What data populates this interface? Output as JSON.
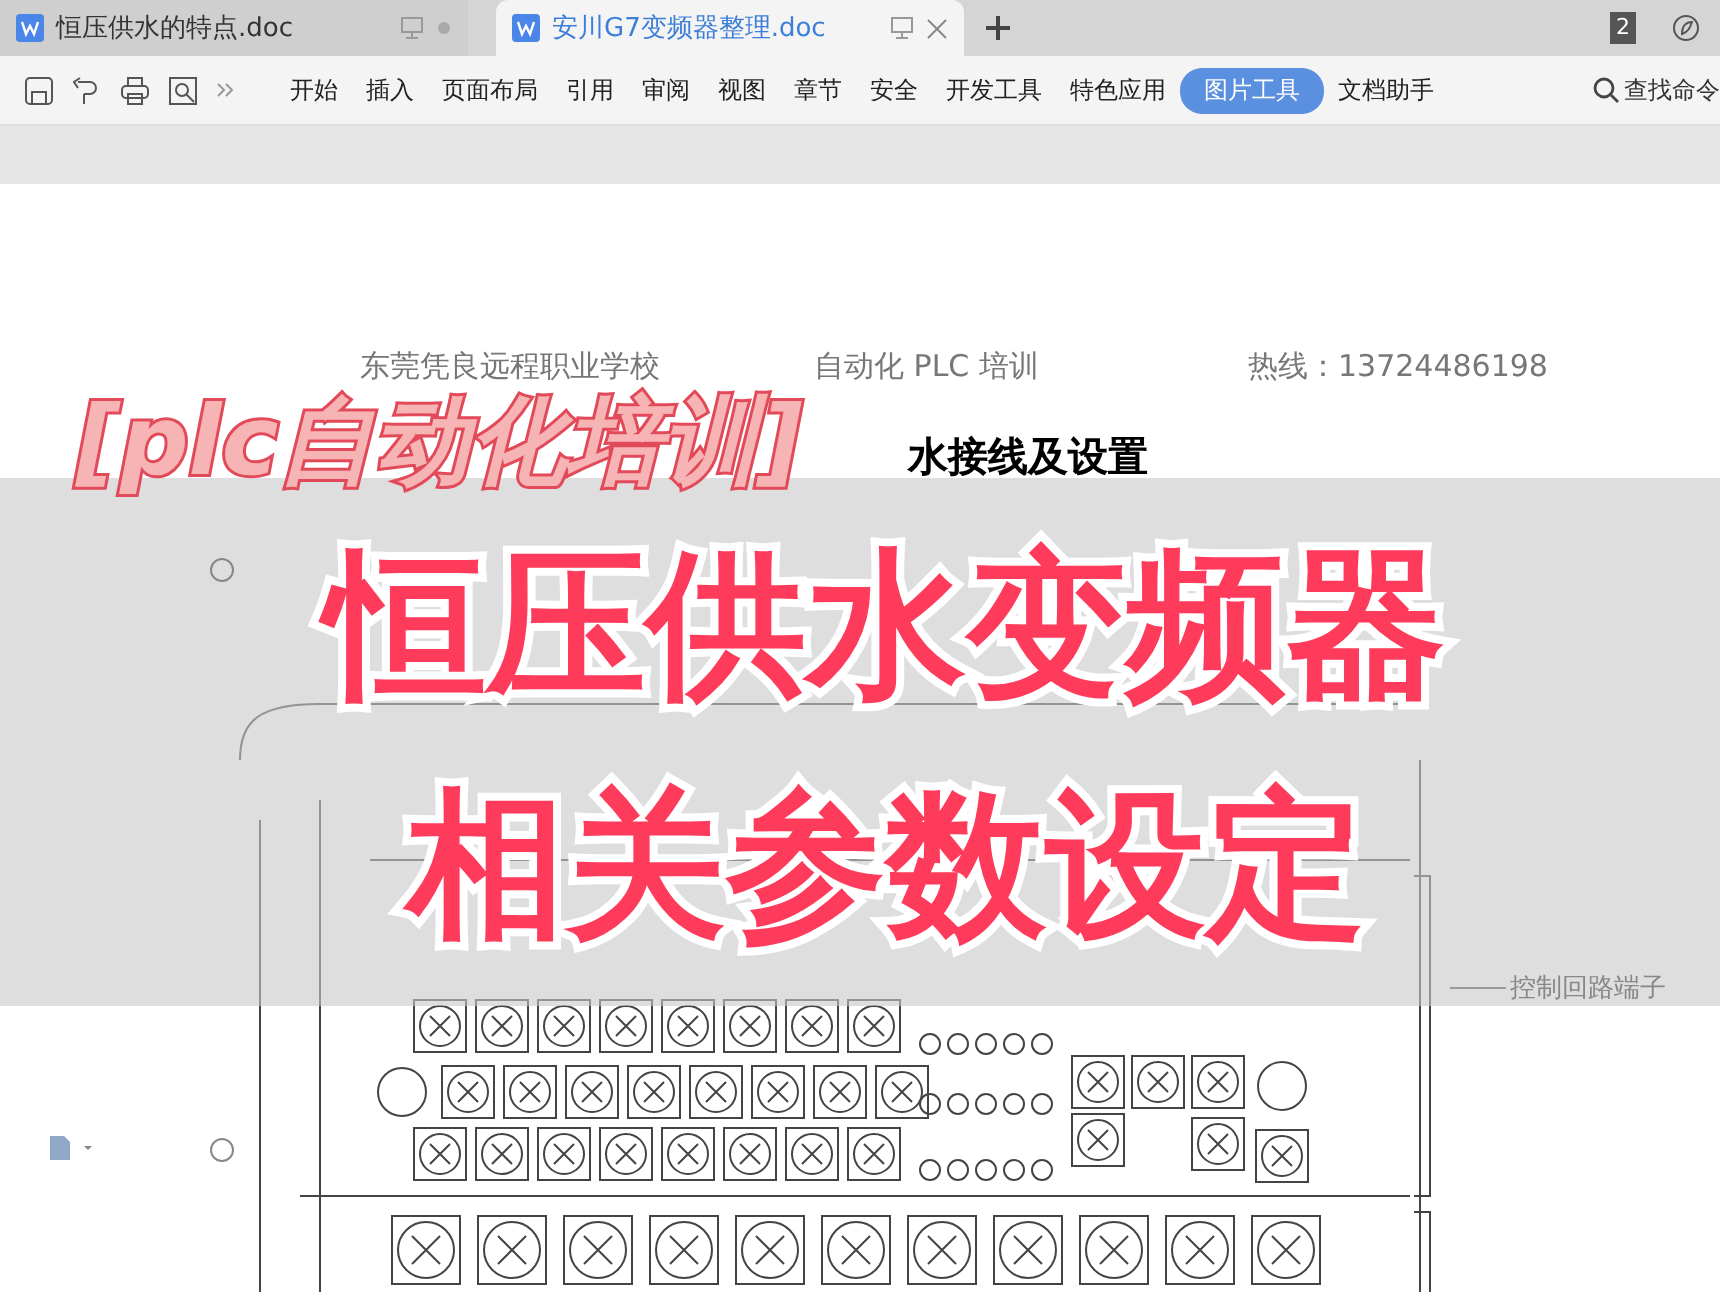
{
  "tabs": [
    {
      "label": "恒压供水的特点.doc",
      "selected": false
    },
    {
      "label": "安川G7变频器整理.doc",
      "selected": true
    }
  ],
  "tab_badge": "2",
  "menu": [
    {
      "label": "开始",
      "selected": false
    },
    {
      "label": "插入",
      "selected": false
    },
    {
      "label": "页面布局",
      "selected": false
    },
    {
      "label": "引用",
      "selected": false
    },
    {
      "label": "审阅",
      "selected": false
    },
    {
      "label": "视图",
      "selected": false
    },
    {
      "label": "章节",
      "selected": false
    },
    {
      "label": "安全",
      "selected": false
    },
    {
      "label": "开发工具",
      "selected": false
    },
    {
      "label": "特色应用",
      "selected": false
    },
    {
      "label": "图片工具",
      "selected": true
    },
    {
      "label": "文档助手",
      "selected": false
    }
  ],
  "search": {
    "placeholder": "查找命令"
  },
  "document": {
    "header": [
      "东莞凭良远程职业学校",
      "自动化 PLC 培训",
      "热线：13724486198"
    ],
    "title_visible": "水接线及设置",
    "diagram_label": "控制回路端子"
  },
  "overlay": {
    "tag": "[plc自动化培训]",
    "headline": [
      "恒压供水变频器",
      "相关参数设定"
    ]
  }
}
